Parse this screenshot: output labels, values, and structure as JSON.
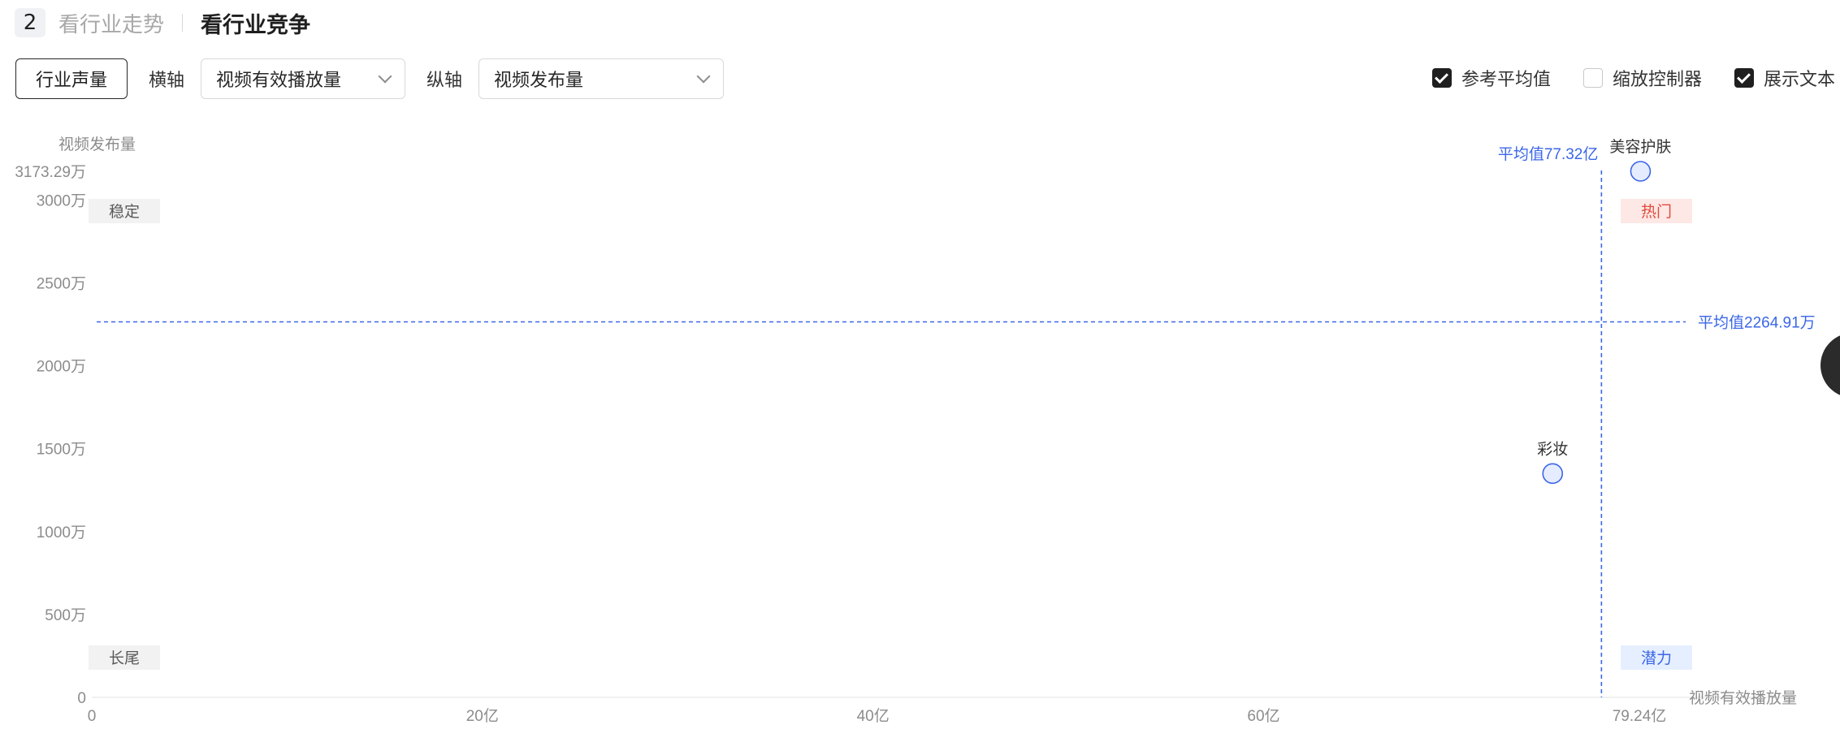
{
  "header": {
    "step_number": "2",
    "tab_trend": "看行业走势",
    "tab_compete": "看行业竞争"
  },
  "controls": {
    "industry_button": "行业声量",
    "x_axis_label": "横轴",
    "x_axis_value": "视频有效播放量",
    "y_axis_label": "纵轴",
    "y_axis_value": "视频发布量"
  },
  "options": [
    {
      "label": "参考平均值",
      "checked": true
    },
    {
      "label": "缩放控制器",
      "checked": false
    },
    {
      "label": "展示文本",
      "checked": true
    }
  ],
  "colors": {
    "accent": "#3b66e8",
    "point_fill": "#e6ecff",
    "hot_bg": "#fde8e6",
    "hot_text": "#e24a3b",
    "potential_bg": "#e6efff",
    "potential_text": "#3b66e8",
    "grey_badge_bg": "#f2f2f2"
  },
  "chart_data": {
    "type": "scatter",
    "xlabel": "视频有效播放量",
    "ylabel": "视频发布量",
    "xlim": [
      0,
      79.24
    ],
    "ylim": [
      0,
      3173.29
    ],
    "x_unit": "亿",
    "y_unit": "万",
    "x_ticks": [
      {
        "value": 0,
        "label": "0"
      },
      {
        "value": 20,
        "label": "20亿"
      },
      {
        "value": 40,
        "label": "40亿"
      },
      {
        "value": 60,
        "label": "60亿"
      },
      {
        "value": 79.24,
        "label": "79.24亿"
      }
    ],
    "y_ticks": [
      {
        "value": 0,
        "label": "0"
      },
      {
        "value": 500,
        "label": "500万"
      },
      {
        "value": 1000,
        "label": "1000万"
      },
      {
        "value": 1500,
        "label": "1500万"
      },
      {
        "value": 2000,
        "label": "2000万"
      },
      {
        "value": 2500,
        "label": "2500万"
      },
      {
        "value": 3000,
        "label": "3000万"
      },
      {
        "value": 3173.29,
        "label": "3173.29万"
      }
    ],
    "points": [
      {
        "name": "美容护肤",
        "x": 79.3,
        "y": 3173.29
      },
      {
        "name": "彩妆",
        "x": 74.8,
        "y": 1350
      }
    ],
    "avg_x": {
      "value": 77.3,
      "label": "平均值77.32亿"
    },
    "avg_y": {
      "value": 2264.91,
      "label": "平均值2264.91万"
    },
    "quadrants": {
      "top_left": "稳定",
      "top_right": "热门",
      "bottom_left": "长尾",
      "bottom_right": "潜力"
    }
  }
}
